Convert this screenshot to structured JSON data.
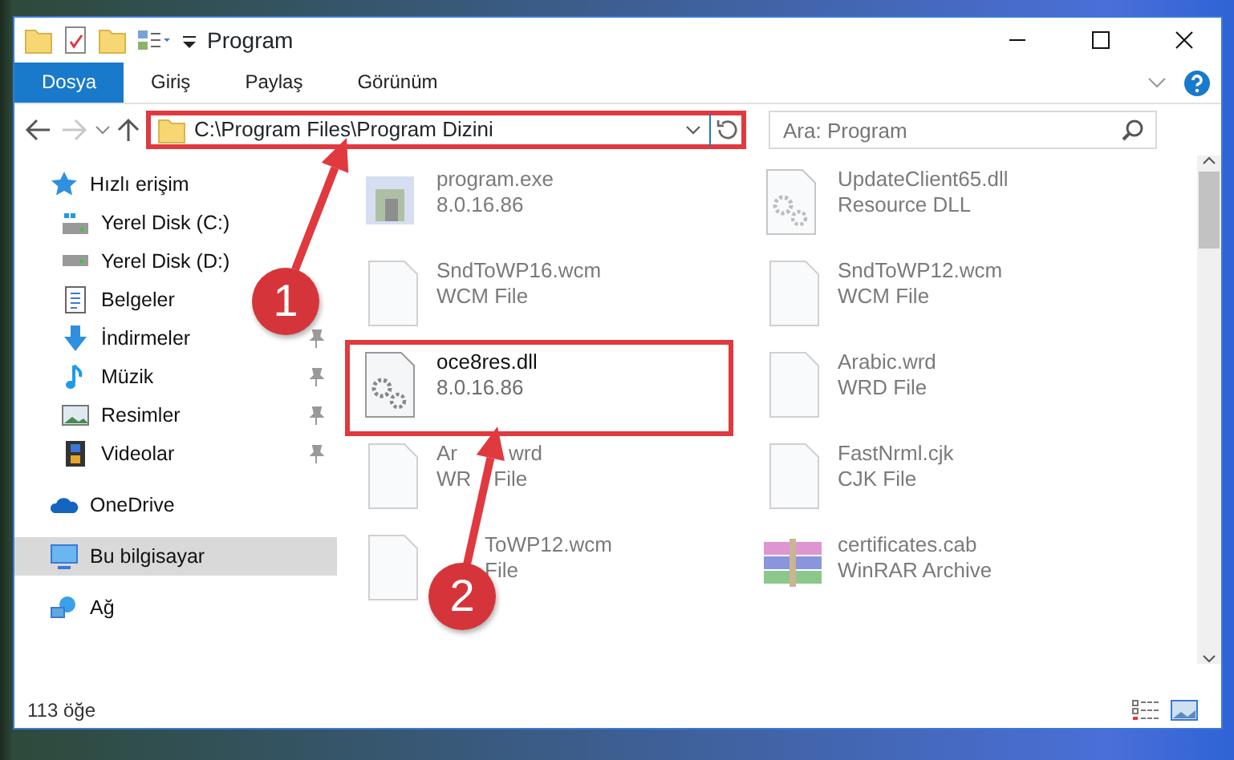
{
  "window": {
    "title": "Program"
  },
  "ribbon": {
    "tabs": [
      {
        "label": "Dosya",
        "selected": true
      },
      {
        "label": "Giriş",
        "selected": false
      },
      {
        "label": "Paylaş",
        "selected": false
      },
      {
        "label": "Görünüm",
        "selected": false
      }
    ]
  },
  "address": {
    "path": "C:\\Program Files\\Program Dizini",
    "highlighted": true
  },
  "search": {
    "placeholder": "Ara: Program"
  },
  "sidebar": {
    "items": [
      {
        "label": "Hızlı erişim",
        "kind": "star",
        "selected": false,
        "children": [
          {
            "label": "Yerel Disk (C:)",
            "kind": "drive-c",
            "pinned": false,
            "selected": false
          },
          {
            "label": "Yerel Disk (D:)",
            "kind": "drive",
            "pinned": false,
            "selected": false
          },
          {
            "label": "Belgeler",
            "kind": "document",
            "pinned": false,
            "selected": false
          },
          {
            "label": "İndirmeler",
            "kind": "download",
            "pinned": true,
            "selected": false
          },
          {
            "label": "Müzik",
            "kind": "music",
            "pinned": true,
            "selected": false
          },
          {
            "label": "Resimler",
            "kind": "pictures",
            "pinned": true,
            "selected": false
          },
          {
            "label": "Videolar",
            "kind": "video",
            "pinned": true,
            "selected": false
          }
        ]
      },
      {
        "label": "OneDrive",
        "kind": "cloud",
        "selected": false
      },
      {
        "label": "Bu bilgisayar",
        "kind": "computer",
        "selected": true
      },
      {
        "label": "Ağ",
        "kind": "network",
        "selected": false
      }
    ]
  },
  "files": [
    {
      "name_parts": [
        "program.exe"
      ],
      "detail_parts": [
        "8.0.16.86"
      ],
      "kind": "app",
      "blurred": true,
      "highlighted": false
    },
    {
      "name_parts": [
        "UpdateClient65.dll"
      ],
      "detail_parts": [
        "Resource DLL"
      ],
      "kind": "dll",
      "blurred": true,
      "highlighted": false
    },
    {
      "name_parts": [
        "SndToWP16.wcm"
      ],
      "detail_parts": [
        "WCM File"
      ],
      "kind": "file",
      "blurred": true,
      "highlighted": false
    },
    {
      "name_parts": [
        "SndToWP12.wcm"
      ],
      "detail_parts": [
        "WCM File"
      ],
      "kind": "file",
      "blurred": true,
      "highlighted": false
    },
    {
      "name_parts": [
        "oce8res.dll"
      ],
      "detail_parts": [
        "8.0.16.86"
      ],
      "kind": "dll",
      "blurred": false,
      "highlighted": true
    },
    {
      "name_parts": [
        "Arabic.wrd"
      ],
      "detail_parts": [
        "WRD File"
      ],
      "kind": "file",
      "blurred": true,
      "highlighted": false
    },
    {
      "name_parts": [
        "Ar",
        "wrd"
      ],
      "detail_parts": [
        "WR",
        "File"
      ],
      "kind": "file",
      "blurred": true,
      "highlighted": false
    },
    {
      "name_parts": [
        "FastNrml.cjk"
      ],
      "detail_parts": [
        "CJK File"
      ],
      "kind": "file",
      "blurred": true,
      "highlighted": false
    },
    {
      "name_parts": [
        "ToWP12.wcm"
      ],
      "detail_parts": [
        "File"
      ],
      "kind": "file",
      "blurred": true,
      "highlighted": false,
      "lead_gap": true
    },
    {
      "name_parts": [
        "certificates.cab"
      ],
      "detail_parts": [
        "WinRAR Archive"
      ],
      "kind": "archive",
      "blurred": true,
      "highlighted": false
    }
  ],
  "status_bar": {
    "count": "113 öğe"
  },
  "annotations": [
    {
      "label": "1"
    },
    {
      "label": "2"
    }
  ]
}
